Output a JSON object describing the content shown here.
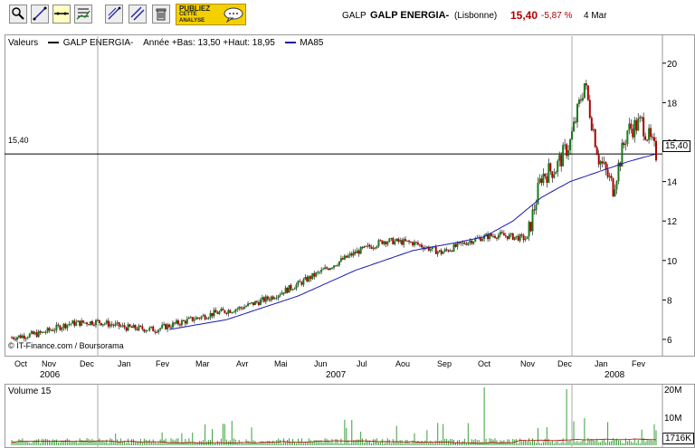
{
  "toolbar": {
    "buttons": [
      "zoom-icon",
      "trendline-icon",
      "horizontal-line-icon",
      "indicator-icon",
      "fibonacci-icon",
      "channel-icon",
      "trash-icon"
    ],
    "ad_line1": "PUBLIEZ",
    "ad_line2": "CETTE",
    "ad_line3": "ANALYSE"
  },
  "header": {
    "ticker": "GALP",
    "name": "GALP ENERGIA-",
    "market": "(Lisbonne)",
    "price": "15,40",
    "change": "-5,87 %",
    "date": "4 Mar"
  },
  "legend": {
    "label": "Valeurs",
    "series1": "GALP ENERGIA-",
    "range": "Année +Bas: 13,50 +Haut: 18,95",
    "series2": "MA85"
  },
  "colors": {
    "up": "#1a7a1a",
    "down": "#b00000",
    "ma": "#1a1ab0",
    "volume": "#3aa03a"
  },
  "copyright": "© IT-Finance.com / Boursorama",
  "price_line_label": "15,40",
  "price_line_value": 15.4,
  "volume_label": "Volume 15",
  "volume_last": "1716K",
  "chart_data": [
    {
      "type": "line",
      "title": "GALP ENERGIA-",
      "ylim": [
        5.5,
        21
      ],
      "y_ticks": [
        "6",
        "8",
        "10",
        "12",
        "14",
        "16",
        "18",
        "20"
      ],
      "x_month_labels": [
        "Oct",
        "Nov",
        "Dec",
        "Jan",
        "Fev",
        "Mar",
        "Avr",
        "Mai",
        "Jun",
        "Jul",
        "Aou",
        "Sep",
        "Oct",
        "Nov",
        "Dec",
        "Jan",
        "Fev"
      ],
      "x_year_labels": [
        "2006",
        "2007",
        "2008"
      ],
      "series": [
        {
          "name": "GALP ENERGIA-",
          "x": [
            0,
            4,
            8,
            12,
            16,
            20,
            24,
            28,
            32,
            36,
            40,
            44,
            48,
            52,
            56,
            60,
            64,
            66,
            68,
            70,
            72,
            74,
            76,
            78,
            80,
            82,
            84,
            86,
            88,
            90
          ],
          "values": [
            6.1,
            6.3,
            6.8,
            6.9,
            6.6,
            6.5,
            6.9,
            7.3,
            7.6,
            8.1,
            8.8,
            9.6,
            10.4,
            11.0,
            10.9,
            10.4,
            11.0,
            11.2,
            11.3,
            11.2,
            11.1,
            14.3,
            14.7,
            16.0,
            19.0,
            15.2,
            13.7,
            16.6,
            17.0,
            15.4
          ]
        },
        {
          "name": "MA85",
          "x": [
            22,
            30,
            40,
            48,
            56,
            62,
            66,
            70,
            74,
            78,
            82,
            86,
            90
          ],
          "values": [
            6.5,
            7.0,
            8.2,
            9.5,
            10.5,
            10.9,
            11.2,
            12.0,
            13.2,
            14.0,
            14.5,
            15.0,
            15.4
          ]
        }
      ]
    },
    {
      "type": "bar",
      "title": "Volume 15",
      "y_ticks": [
        "20M",
        "10M",
        "1716K"
      ],
      "ylim": [
        0,
        22000000
      ]
    }
  ]
}
